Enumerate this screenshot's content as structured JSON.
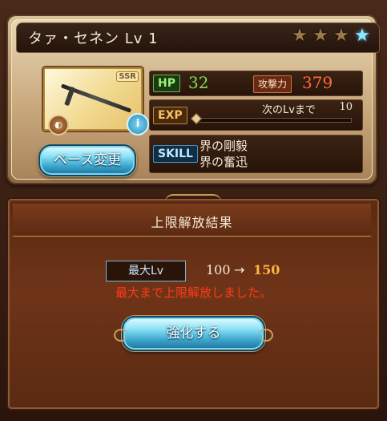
{
  "character": {
    "name": "タァ・セネン Lv 1",
    "stars_total": 4,
    "stars_lit": 1,
    "rarity": "SSR",
    "element_icon": "element-icon",
    "info_icon": "i"
  },
  "stats": {
    "hp_label": "HP",
    "hp_value": "32",
    "atk_label": "攻撃力",
    "atk_value": "379",
    "exp_label": "EXP",
    "next_lv_label": "次のLvまで",
    "next_lv_value": "10",
    "exp_progress": 0
  },
  "skill": {
    "label": "SKILL",
    "lines": [
      "界の剛毅",
      "界の奮迅"
    ]
  },
  "buttons": {
    "base_change": "ベース変更",
    "upgrade": "強化する"
  },
  "result": {
    "title": "上限解放結果",
    "max_lv_label": "最大Lv",
    "old_value": "100",
    "arrow": "→",
    "new_value": "150",
    "message": "最大まで上限解放しました。"
  },
  "colors": {
    "hp": "#7fe04a",
    "atk": "#ff6a3a",
    "new_value": "#ffb640",
    "message": "#ff3a1a",
    "lit_star": "#8fe8ff"
  }
}
